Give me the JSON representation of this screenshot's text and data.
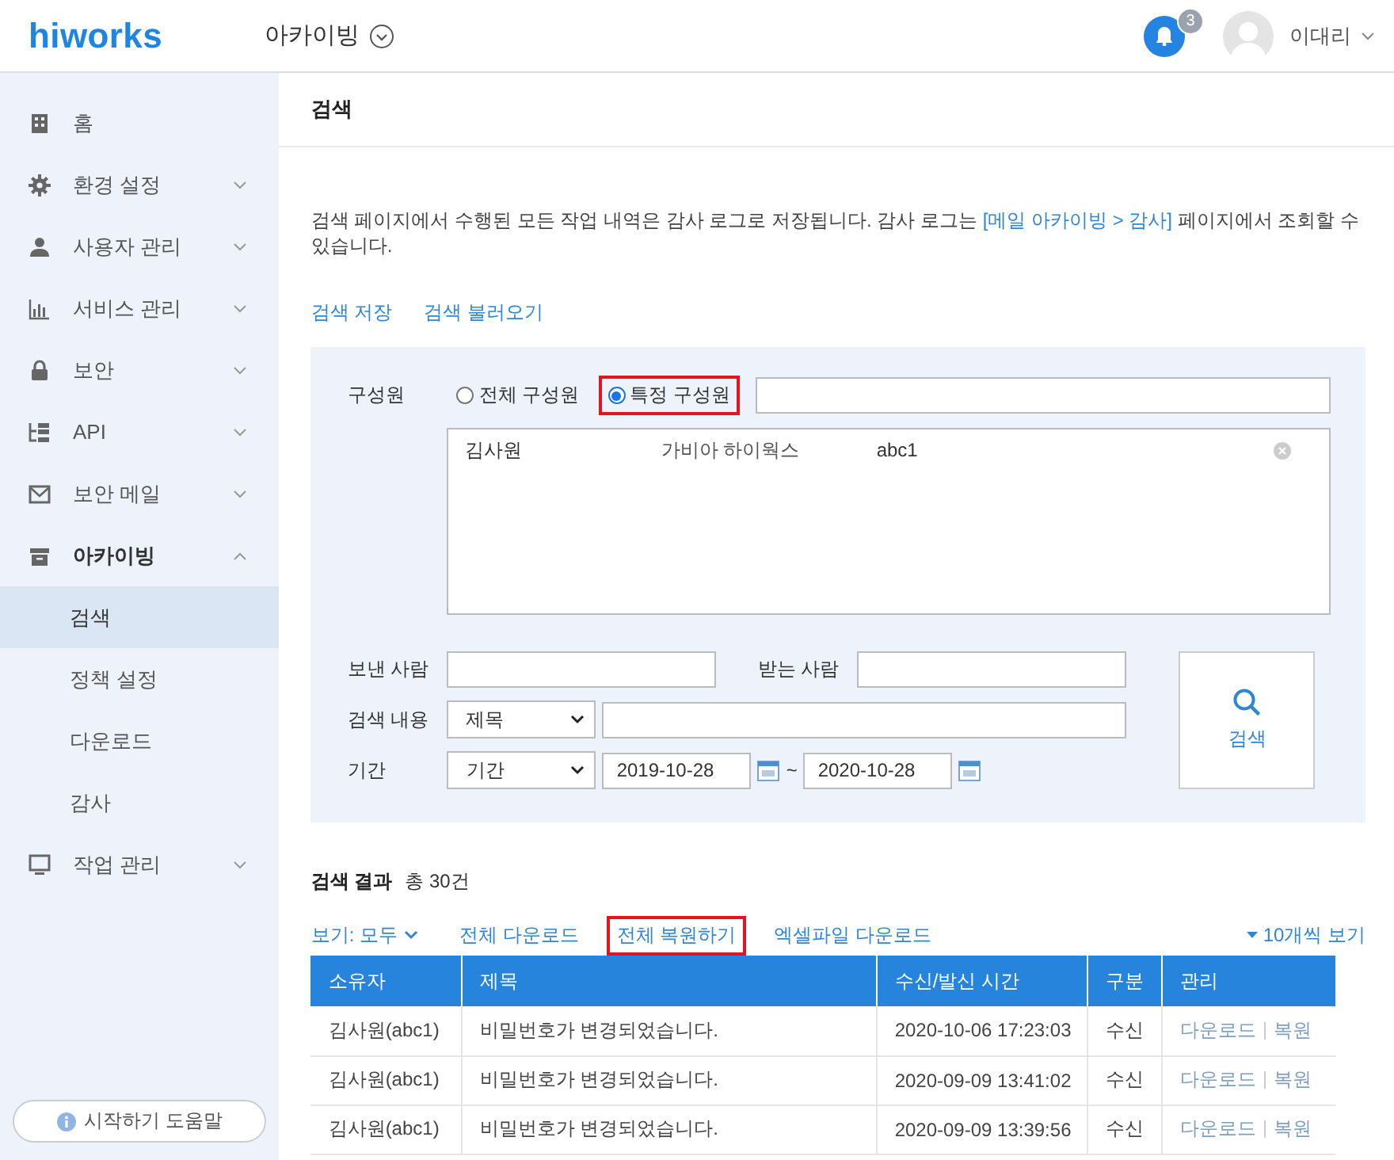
{
  "header": {
    "logo": "hiworks",
    "app_menu": "아카이빙",
    "notification_count": "3",
    "user_name": "이대리"
  },
  "sidebar": {
    "items": [
      {
        "kind": "link",
        "label": "홈"
      },
      {
        "kind": "group",
        "label": "환경 설정",
        "expanded": false
      },
      {
        "kind": "group",
        "label": "사용자 관리",
        "expanded": false
      },
      {
        "kind": "group",
        "label": "서비스 관리",
        "expanded": false
      },
      {
        "kind": "group",
        "label": "보안",
        "expanded": false
      },
      {
        "kind": "group",
        "label": "API",
        "expanded": false
      },
      {
        "kind": "group",
        "label": "보안 메일",
        "expanded": false
      },
      {
        "kind": "group",
        "label": "아카이빙",
        "expanded": true,
        "children": [
          {
            "label": "검색",
            "selected": true
          },
          {
            "label": "정책 설정",
            "selected": false
          },
          {
            "label": "다운로드",
            "selected": false
          },
          {
            "label": "감사",
            "selected": false
          }
        ]
      },
      {
        "kind": "group",
        "label": "작업 관리",
        "expanded": false
      }
    ],
    "help_button": "시작하기 도움말"
  },
  "page_title": "검색",
  "notice": {
    "before": "검색 페이지에서 수행된 모든 작업 내역은 감사 로그로 저장됩니다. 감사 로그는 ",
    "link": "[메일 아카이빙 > 감사]",
    "after": " 페이지에서 조회할 수 있습니다."
  },
  "search_actions": [
    "검색 저장",
    "검색 불러오기"
  ],
  "search_form": {
    "member_label": "구성원",
    "member_scope": [
      {
        "label": "전체 구성원",
        "selected": false,
        "highlighted": false
      },
      {
        "label": "특정 구성원",
        "selected": true,
        "highlighted": true
      }
    ],
    "selected_members": [
      {
        "name": "김사원",
        "company": "가비아 하이웍스",
        "id": "abc1"
      }
    ],
    "sender_label": "보낸 사람",
    "recipient_label": "받는 사람",
    "content_label": "검색 내용",
    "content_select": "제목",
    "period_label": "기간",
    "period_select": "기간",
    "date_from": "2019-10-28",
    "date_separator": "~",
    "date_to": "2020-10-28",
    "search_button": "검색"
  },
  "results": {
    "title": "검색 결과",
    "total": "총 30건",
    "view_filter": "보기: 모두",
    "actions": [
      {
        "label": "전체 다운로드",
        "highlighted": false
      },
      {
        "label": "전체 복원하기",
        "highlighted": true
      },
      {
        "label": "엑셀파일 다운로드",
        "highlighted": false
      }
    ],
    "page_size": "10개씩 보기",
    "table": {
      "columns": [
        "소유자",
        "제목",
        "수신/발신 시간",
        "구분",
        "관리"
      ],
      "rows": [
        {
          "owner": "김사원(abc1)",
          "subject": "비밀번호가 변경되었습니다.",
          "time": "2020-10-06 17:23:03",
          "type": "수신",
          "actions": [
            "다운로드",
            "복원"
          ]
        },
        {
          "owner": "김사원(abc1)",
          "subject": "비밀번호가 변경되었습니다.",
          "time": "2020-09-09 13:41:02",
          "type": "수신",
          "actions": [
            "다운로드",
            "복원"
          ]
        },
        {
          "owner": "김사원(abc1)",
          "subject": "비밀번호가 변경되었습니다.",
          "time": "2020-09-09 13:39:56",
          "type": "수신",
          "actions": [
            "다운로드",
            "복원"
          ]
        }
      ]
    }
  }
}
